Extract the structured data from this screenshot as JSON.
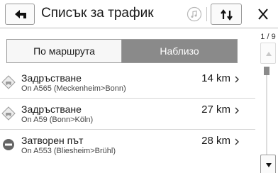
{
  "header": {
    "title": "Списък за трафик",
    "back_icon": "back-arrow-icon",
    "audio_icon": "music-note-icon",
    "sort_icon": "sort-arrows-icon",
    "close_icon": "close-icon"
  },
  "tabs": [
    {
      "label": "По маршрута",
      "selected": false
    },
    {
      "label": "Наблизо",
      "selected": true
    }
  ],
  "pagination": {
    "label": "1 / 9"
  },
  "items": [
    {
      "title": "Задръстване",
      "subtitle": "On  A565 (Meckenheim>Bonn)",
      "distance": "14 km",
      "icon": "traffic-jam-icon"
    },
    {
      "title": "Задръстване",
      "subtitle": "On  A59 (Bonn>Köln)",
      "distance": "27 km",
      "icon": "traffic-jam-icon"
    },
    {
      "title": "Затворен път",
      "subtitle": "On  A553 (Bliesheim>Brühl)",
      "distance": "28 km",
      "icon": "road-closed-icon"
    }
  ],
  "colors": {
    "selected_tab": "#8a8a8a",
    "road_closed": "#666666"
  }
}
